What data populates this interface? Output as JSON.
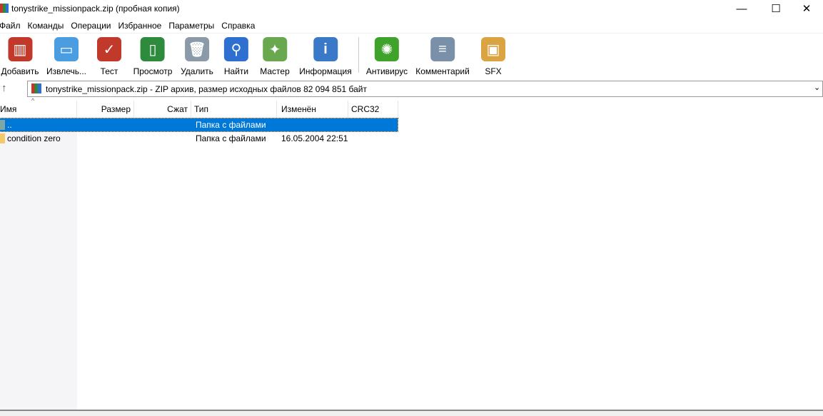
{
  "window": {
    "title": "tonystrike_missionpack.zip (пробная копия)",
    "minimize": "—",
    "maximize": "☐",
    "close": "✕"
  },
  "menu": [
    "Файл",
    "Команды",
    "Операции",
    "Избранное",
    "Параметры",
    "Справка"
  ],
  "toolbar": [
    {
      "label": "Добавить",
      "icon": "add-archive-icon",
      "color": "#c0392b"
    },
    {
      "label": "Извлечь...",
      "icon": "extract-folder-icon",
      "color": "#4a9de0"
    },
    {
      "label": "Тест",
      "icon": "test-clipboard-icon",
      "color": "#c0392b"
    },
    {
      "label": "Просмотр",
      "icon": "view-book-icon",
      "color": "#2e8b3d"
    },
    {
      "label": "Удалить",
      "icon": "delete-trash-icon",
      "color": "#8a9aa8"
    },
    {
      "label": "Найти",
      "icon": "find-magnifier-icon",
      "color": "#2e6fd0"
    },
    {
      "label": "Мастер",
      "icon": "wizard-wand-icon",
      "color": "#6aa84f"
    },
    {
      "label": "Информация",
      "icon": "info-icon",
      "color": "#3a78c8"
    },
    {
      "label": "Антивирус",
      "icon": "antivirus-icon",
      "color": "#3fa22b"
    },
    {
      "label": "Комментарий",
      "icon": "comment-icon",
      "color": "#7a8fa8"
    },
    {
      "label": "SFX",
      "icon": "sfx-box-icon",
      "color": "#d9a441"
    }
  ],
  "address": {
    "text": "tonystrike_missionpack.zip - ZIP архив, размер исходных файлов 82 094 851 байт"
  },
  "columns": [
    "Имя",
    "Размер",
    "Сжат",
    "Тип",
    "Изменён",
    "CRC32"
  ],
  "rows": [
    {
      "name": "..",
      "type": "Папка с файлами",
      "modified": ""
    },
    {
      "name": "condition zero",
      "type": "Папка с файлами",
      "modified": "16.05.2004 22:51"
    }
  ]
}
